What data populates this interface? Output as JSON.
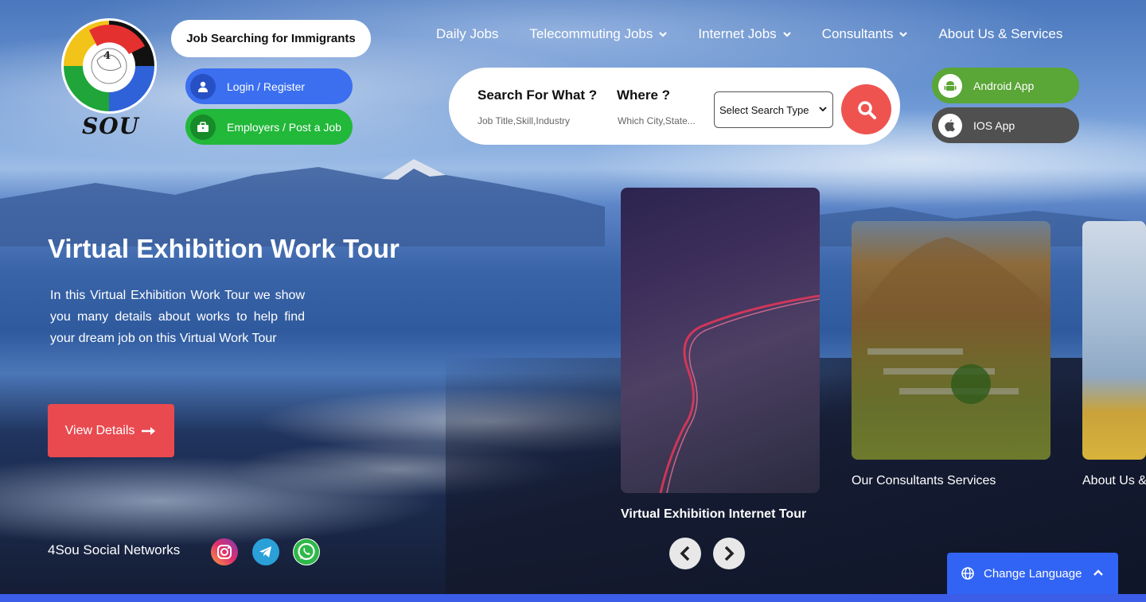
{
  "brand": {
    "logo_text": "SOU",
    "logo_badge": "4"
  },
  "header": {
    "title": "Job Searching for Immigrants",
    "login_label": "Login / Register",
    "employers_label": "Employers / Post a Job"
  },
  "nav": {
    "items": [
      {
        "label": "Daily Jobs",
        "has_dropdown": false
      },
      {
        "label": "Telecommuting Jobs",
        "has_dropdown": true
      },
      {
        "label": "Internet Jobs",
        "has_dropdown": true
      },
      {
        "label": "Consultants",
        "has_dropdown": true
      },
      {
        "label": "About Us & Services",
        "has_dropdown": false
      }
    ]
  },
  "search": {
    "what_label": "Search For What ?",
    "what_placeholder": "Job Title,Skill,Industry",
    "where_label": "Where ?",
    "where_placeholder": "Which City,State...",
    "type_select": "Select Search Type",
    "button_icon": "search-icon"
  },
  "apps": {
    "android_label": "Android App",
    "ios_label": "IOS App"
  },
  "hero": {
    "title": "Virtual Exhibition Work Tour",
    "description": "In this Virtual Exhibition Work Tour we show you many details about works to help find your dream job on this Virtual Work Tour",
    "button_label": "View Details"
  },
  "social": {
    "label": "4Sou Social Networks",
    "networks": [
      "instagram-icon",
      "telegram-icon",
      "whatsapp-icon"
    ]
  },
  "carousel": {
    "cards": [
      {
        "caption": "Virtual Exhibition Internet Tour"
      },
      {
        "caption": "Our Consultants Services"
      },
      {
        "caption": "About Us &"
      }
    ]
  },
  "language": {
    "label": "Change Language"
  },
  "colors": {
    "accent_blue": "#3164f4",
    "login_blue": "#3b6ff0",
    "employers_green": "#22b83a",
    "search_red": "#ef5350",
    "view_details_red": "#e84a4f",
    "android_green": "#5aa636",
    "ios_gray": "#505050"
  }
}
